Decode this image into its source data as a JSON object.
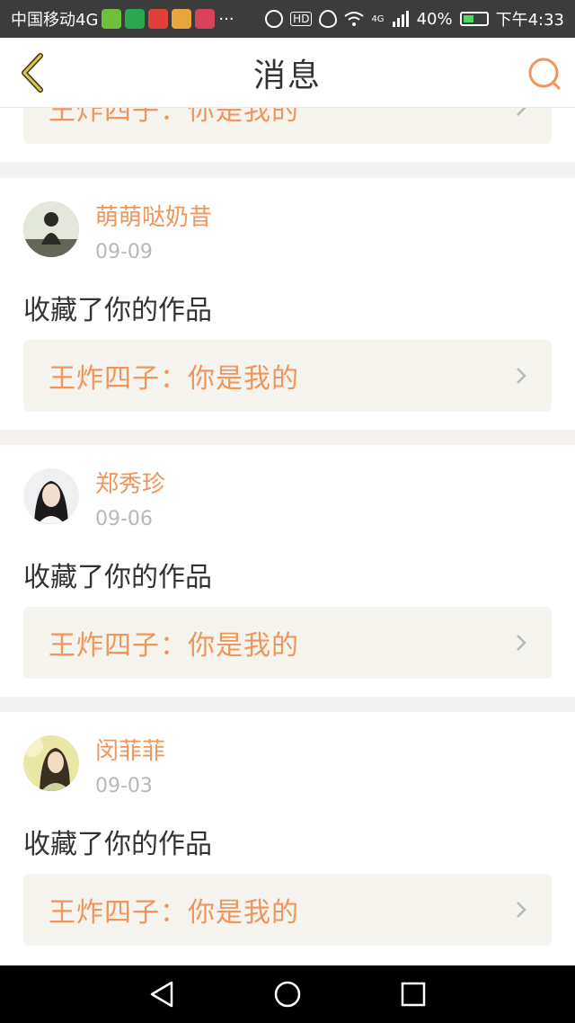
{
  "status_bar": {
    "carrier": "中国移动4G",
    "more": "···",
    "hd": "HD",
    "signal_tag": "4G",
    "battery": "40%",
    "time": "下午4:33"
  },
  "header": {
    "title": "消息",
    "back_icon": "chevron-left-icon",
    "search_icon": "search-icon"
  },
  "messages": [
    {
      "username": "",
      "date": "",
      "action": "",
      "work_title": "王炸四子：你是我的"
    },
    {
      "username": "萌萌哒奶昔",
      "date": "09-09",
      "action": "收藏了你的作品",
      "work_title": "王炸四子：你是我的"
    },
    {
      "username": "郑秀珍",
      "date": "09-06",
      "action": "收藏了你的作品",
      "work_title": "王炸四子：你是我的"
    },
    {
      "username": "闵菲菲",
      "date": "09-03",
      "action": "收藏了你的作品",
      "work_title": "王炸四子：你是我的"
    }
  ],
  "colors": {
    "accent": "#f0955b",
    "date_gray": "#b8b8b8",
    "card_bg": "#ffffff",
    "link_bg": "#f6f4ee",
    "page_bg": "#f4f3f1"
  },
  "nav": {
    "back": "triangle-back-icon",
    "home": "circle-home-icon",
    "recent": "square-recent-icon"
  }
}
